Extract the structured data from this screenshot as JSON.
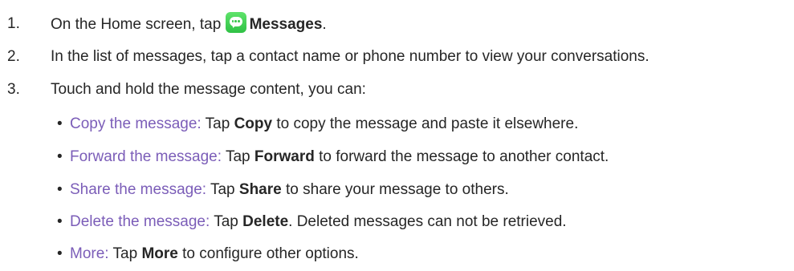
{
  "steps": [
    {
      "number": "1.",
      "text_before": "On the Home screen, tap",
      "app_name": "Messages",
      "text_after": "."
    },
    {
      "number": "2.",
      "text": "In the list of messages, tap a contact name or phone number to view your conversations."
    },
    {
      "number": "3.",
      "text": "Touch and hold the message content, you can:"
    }
  ],
  "bullets": [
    {
      "term": "Copy the message:",
      "pre": " Tap ",
      "action": "Copy",
      "post": " to copy the message and paste it elsewhere."
    },
    {
      "term": "Forward the message:",
      "pre": " Tap ",
      "action": "Forward",
      "post": " to forward the message to another contact."
    },
    {
      "term": "Share the message:",
      "pre": " Tap ",
      "action": "Share",
      "post": " to share your message to others."
    },
    {
      "term": "Delete the message:",
      "pre": " Tap ",
      "action": "Delete",
      "post": ". Deleted messages can not be retrieved."
    },
    {
      "term": "More:",
      "pre": " Tap ",
      "action": "More",
      "post": " to configure other options."
    }
  ],
  "bullet_symbol": "•",
  "colors": {
    "text": "#262626",
    "term": "#7b5db8",
    "icon": "#3bc84e"
  },
  "icons": {
    "messages_app": "messages-app-icon"
  }
}
